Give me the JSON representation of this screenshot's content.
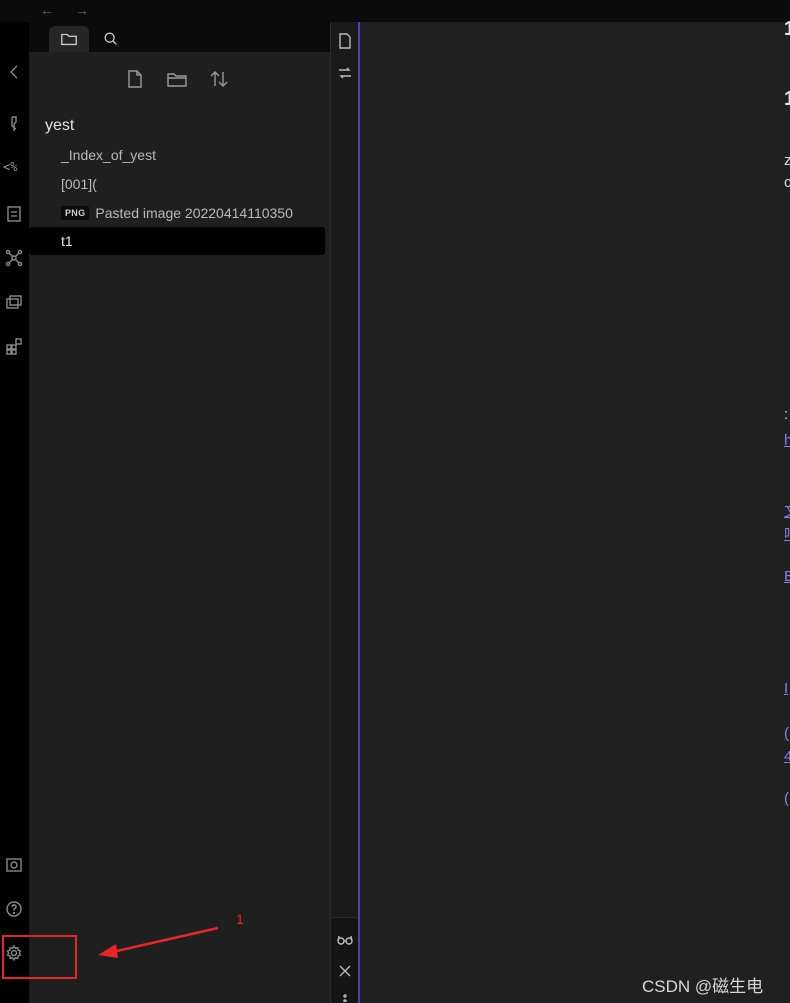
{
  "titlebar": {
    "back_arrow": "←",
    "forward_arrow": "→"
  },
  "ribbon": {
    "icons": [
      "collapse-chevron-icon",
      "link-plugin-icon",
      "templater-icon",
      "document-icon",
      "graph-icon",
      "slides-icon",
      "kanban-grid-icon"
    ],
    "templater_label": "<%",
    "bottom_icons": [
      "vault-icon",
      "help-icon",
      "settings-gear-icon"
    ]
  },
  "explorer": {
    "tabs": [
      {
        "name": "files-tab",
        "icon": "folder-icon",
        "active": true
      },
      {
        "name": "search-tab",
        "icon": "search-icon",
        "active": false
      }
    ],
    "toolbar": [
      "new-note-icon",
      "new-folder-icon",
      "sort-icon"
    ],
    "folder_name": "yest",
    "files": [
      {
        "label": "_Index_of_yest",
        "badge": "",
        "selected": false
      },
      {
        "label": "[001](",
        "badge": "",
        "selected": false
      },
      {
        "label": "Pasted image 20220414110350",
        "badge": "PNG",
        "selected": false
      },
      {
        "label": "t1",
        "badge": "",
        "selected": true
      }
    ]
  },
  "midbar": {
    "icons": [
      "file-icon",
      "swap-icon"
    ],
    "bottom_icons": [
      "reading-glasses-icon",
      "close-icon",
      "more-icon"
    ]
  },
  "colors": {
    "accent": "#4b3fc4",
    "annotation": "#e8262a",
    "link": "#8b7cf6"
  },
  "annotation": {
    "number": "1"
  },
  "watermark": "CSDN @磁生电"
}
